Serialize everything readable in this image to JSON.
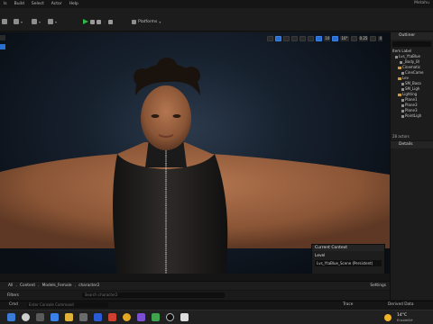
{
  "menu": {
    "items": [
      "ls",
      "Build",
      "Select",
      "Actor",
      "Help"
    ],
    "window_title": "Metahu"
  },
  "toolbar": {
    "platforms_label": "Platforms"
  },
  "viewport": {
    "values": [
      "10",
      "10°",
      "0.25",
      "4"
    ]
  },
  "outliner": {
    "title": "Outliner",
    "rows": [
      {
        "label": "Item Label",
        "type": "header"
      },
      {
        "label": "Lvs_YtaBlue",
        "type": "object"
      },
      {
        "label": "_Body_Bl",
        "type": "object"
      },
      {
        "label": "Cinematic",
        "type": "folder"
      },
      {
        "label": "CineCame",
        "type": "object"
      },
      {
        "label": "Lev",
        "type": "folder"
      },
      {
        "label": "SM_Basa",
        "type": "object"
      },
      {
        "label": "SM_Ligh",
        "type": "object"
      },
      {
        "label": "Lighting",
        "type": "folder"
      },
      {
        "label": "Plane1",
        "type": "object"
      },
      {
        "label": "Plane3",
        "type": "object"
      },
      {
        "label": "Plane3",
        "type": "object"
      },
      {
        "label": "PointLigh",
        "type": "object"
      }
    ],
    "footer": "28 actors"
  },
  "details": {
    "title": "Details"
  },
  "current_context": {
    "title": "Current Context",
    "level_label": "Level",
    "level_value": "Lvs_YtaBlue_Scene (Persistent)"
  },
  "content_browser": {
    "breadcrumb": [
      "All",
      "Content",
      "Models_Female",
      "character2"
    ],
    "settings_label": "Settings",
    "filters_label": "Filters",
    "search_placeholder": "Search character2"
  },
  "status": {
    "left": "Cmd",
    "cmd_placeholder": "Enter Console Command",
    "trace": "Trace",
    "derived": "Derived Data"
  },
  "taskbar": {
    "weather_temp": "14°C",
    "weather_desc": "Ensoleillé"
  },
  "colors": {
    "accent": "#2a6fcf",
    "play": "#2fb84a",
    "folder": "#c79a3d"
  }
}
